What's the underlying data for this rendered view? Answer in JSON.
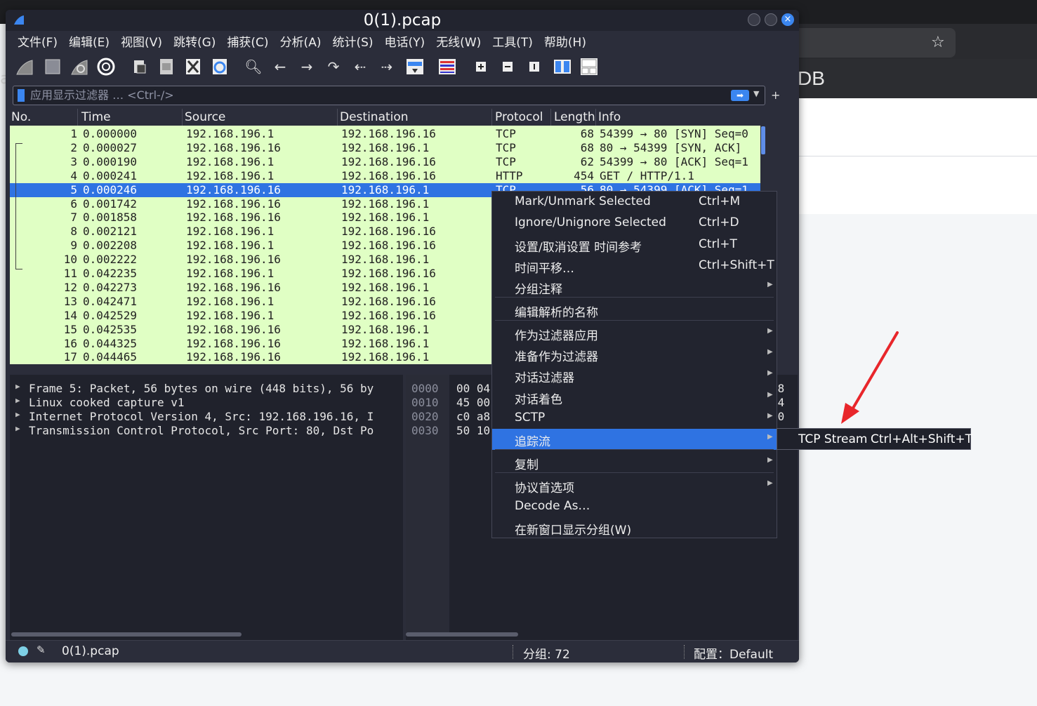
{
  "window": {
    "title": "0(1).pcap"
  },
  "menubar": [
    "文件(F)",
    "编辑(E)",
    "视图(V)",
    "跳转(G)",
    "捕获(C)",
    "分析(A)",
    "统计(S)",
    "电话(Y)",
    "无线(W)",
    "工具(T)",
    "帮助(H)"
  ],
  "toolbar": {
    "icons": [
      "start-capture-icon",
      "stop-capture-icon",
      "restart-capture-icon",
      "capture-options-icon",
      "open-file-icon",
      "save-file-icon",
      "close-file-icon",
      "reload-file-icon",
      "find-packet-icon",
      "go-back-icon",
      "go-forward-icon",
      "go-to-packet-icon",
      "first-packet-icon",
      "last-packet-icon",
      "autoscroll-icon",
      "colorize-icon",
      "zoom-in-icon",
      "zoom-out-icon",
      "normal-size-icon",
      "resize-columns-icon",
      "layout-icon"
    ]
  },
  "filter": {
    "placeholder": "应用显示过滤器 … <Ctrl-/>"
  },
  "packet_list": {
    "columns": [
      "No.",
      "Time",
      "Source",
      "Destination",
      "Protocol",
      "Length",
      "Info"
    ],
    "rows": [
      {
        "no": "1",
        "time": "0.000000",
        "src": "192.168.196.1",
        "dst": "192.168.196.16",
        "proto": "TCP",
        "len": "68",
        "info": "54399 → 80 [SYN] Seq=0"
      },
      {
        "no": "2",
        "time": "0.000027",
        "src": "192.168.196.16",
        "dst": "192.168.196.1",
        "proto": "TCP",
        "len": "68",
        "info": "80 → 54399 [SYN, ACK]"
      },
      {
        "no": "3",
        "time": "0.000190",
        "src": "192.168.196.1",
        "dst": "192.168.196.16",
        "proto": "TCP",
        "len": "62",
        "info": "54399 → 80 [ACK] Seq=1"
      },
      {
        "no": "4",
        "time": "0.000241",
        "src": "192.168.196.1",
        "dst": "192.168.196.16",
        "proto": "HTTP",
        "len": "454",
        "info": "GET / HTTP/1.1"
      },
      {
        "no": "5",
        "time": "0.000246",
        "src": "192.168.196.16",
        "dst": "192.168.196.1",
        "proto": "TCP",
        "len": "56",
        "info": "80 → 54399 [ACK] Seq=1"
      },
      {
        "no": "6",
        "time": "0.001742",
        "src": "192.168.196.16",
        "dst": "192.168.196.1",
        "proto": "",
        "len": "",
        "info": ""
      },
      {
        "no": "7",
        "time": "0.001858",
        "src": "192.168.196.16",
        "dst": "192.168.196.1",
        "proto": "",
        "len": "",
        "info": ""
      },
      {
        "no": "8",
        "time": "0.002121",
        "src": "192.168.196.1",
        "dst": "192.168.196.16",
        "proto": "",
        "len": "",
        "info": ""
      },
      {
        "no": "9",
        "time": "0.002208",
        "src": "192.168.196.1",
        "dst": "192.168.196.16",
        "proto": "",
        "len": "",
        "info": ""
      },
      {
        "no": "10",
        "time": "0.002222",
        "src": "192.168.196.16",
        "dst": "192.168.196.1",
        "proto": "",
        "len": "",
        "info": ""
      },
      {
        "no": "11",
        "time": "0.042235",
        "src": "192.168.196.1",
        "dst": "192.168.196.16",
        "proto": "",
        "len": "",
        "info": ""
      },
      {
        "no": "12",
        "time": "0.042273",
        "src": "192.168.196.16",
        "dst": "192.168.196.1",
        "proto": "",
        "len": "",
        "info": ""
      },
      {
        "no": "13",
        "time": "0.042471",
        "src": "192.168.196.1",
        "dst": "192.168.196.16",
        "proto": "",
        "len": "",
        "info": ""
      },
      {
        "no": "14",
        "time": "0.042529",
        "src": "192.168.196.1",
        "dst": "192.168.196.16",
        "proto": "",
        "len": "",
        "info": ""
      },
      {
        "no": "15",
        "time": "0.042535",
        "src": "192.168.196.16",
        "dst": "192.168.196.1",
        "proto": "",
        "len": "",
        "info": ""
      },
      {
        "no": "16",
        "time": "0.044325",
        "src": "192.168.196.16",
        "dst": "192.168.196.1",
        "proto": "",
        "len": "",
        "info": ""
      },
      {
        "no": "17",
        "time": "0.044465",
        "src": "192.168.196.16",
        "dst": "192.168.196.1",
        "proto": "",
        "len": "",
        "info": ""
      }
    ],
    "selected_row": 5
  },
  "details": [
    "Frame 5: Packet, 56 bytes on wire (448 bits), 56 by",
    "Linux cooked capture v1",
    "Internet Protocol Version 4, Src: 192.168.196.16, I",
    "Transmission Control Protocol, Src Port: 80, Dst Po"
  ],
  "bytes": [
    {
      "offset": "0000",
      "hex": "00 04",
      "right": "08"
    },
    {
      "offset": "0010",
      "hex": "45 00",
      "right": "c4"
    },
    {
      "offset": "0020",
      "hex": "c0 a8",
      "right": "c0"
    },
    {
      "offset": "0030",
      "hex": "50 10",
      "right": ""
    }
  ],
  "context_menu": [
    {
      "label": "Mark/Unmark Selected",
      "shortcut": "Ctrl+M",
      "submenu": false
    },
    {
      "label": "Ignore/Unignore Selected",
      "shortcut": "Ctrl+D",
      "submenu": false
    },
    {
      "label": "设置/取消设置 时间参考",
      "shortcut": "Ctrl+T",
      "submenu": false
    },
    {
      "label": "时间平移…",
      "shortcut": "Ctrl+Shift+T",
      "submenu": false
    },
    {
      "label": "分组注释",
      "shortcut": "",
      "submenu": true
    },
    {
      "label": "编辑解析的名称",
      "shortcut": "",
      "submenu": false
    },
    {
      "label": "作为过滤器应用",
      "shortcut": "",
      "submenu": true
    },
    {
      "label": "准备作为过滤器",
      "shortcut": "",
      "submenu": true
    },
    {
      "label": "对话过滤器",
      "shortcut": "",
      "submenu": true
    },
    {
      "label": "对话着色",
      "shortcut": "",
      "submenu": true
    },
    {
      "label": "SCTP",
      "shortcut": "",
      "submenu": true
    },
    {
      "label": "追踪流",
      "shortcut": "",
      "submenu": true
    },
    {
      "label": "复制",
      "shortcut": "",
      "submenu": true
    },
    {
      "label": "协议首选项",
      "shortcut": "",
      "submenu": true
    },
    {
      "label": "Decode As…",
      "shortcut": "",
      "submenu": false
    },
    {
      "label": "在新窗口显示分组(W)",
      "shortcut": "",
      "submenu": false
    }
  ],
  "submenu": {
    "label": "TCP Stream",
    "shortcut": "Ctrl+Alt+Shift+T"
  },
  "statusbar": {
    "file": "0(1).pcap",
    "packets": "分组: 72",
    "profile": "配置：Default"
  },
  "background": {
    "partial_text": "DB",
    "left_edge_text": "a"
  },
  "colors": {
    "accent": "#2f73e2",
    "row_bg": "#e0ffc4",
    "annotation": "#e8262b"
  }
}
